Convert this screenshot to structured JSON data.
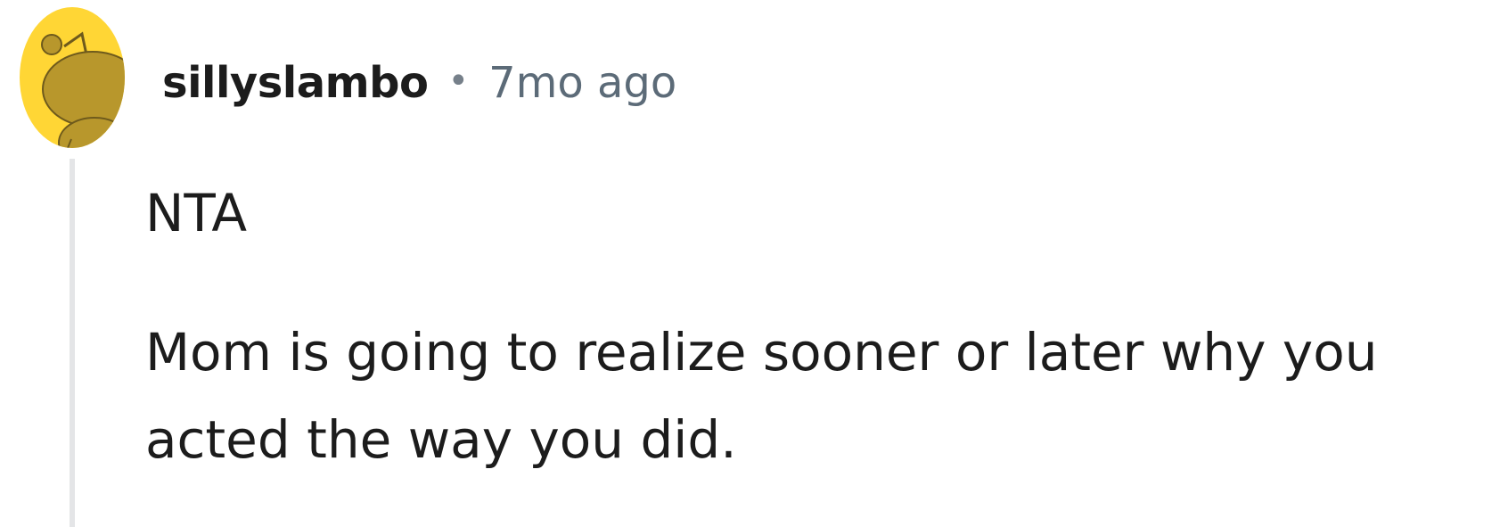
{
  "comment": {
    "author": "sillyslambo",
    "separator": "•",
    "age": "7mo ago",
    "avatar_icon": "snoo-avatar-icon",
    "avatar_bg": "#ffd635",
    "avatar_fg": "#b8972c",
    "paragraphs": [
      "NTA",
      "Mom is going to realize sooner or later why you acted the way you did."
    ]
  }
}
